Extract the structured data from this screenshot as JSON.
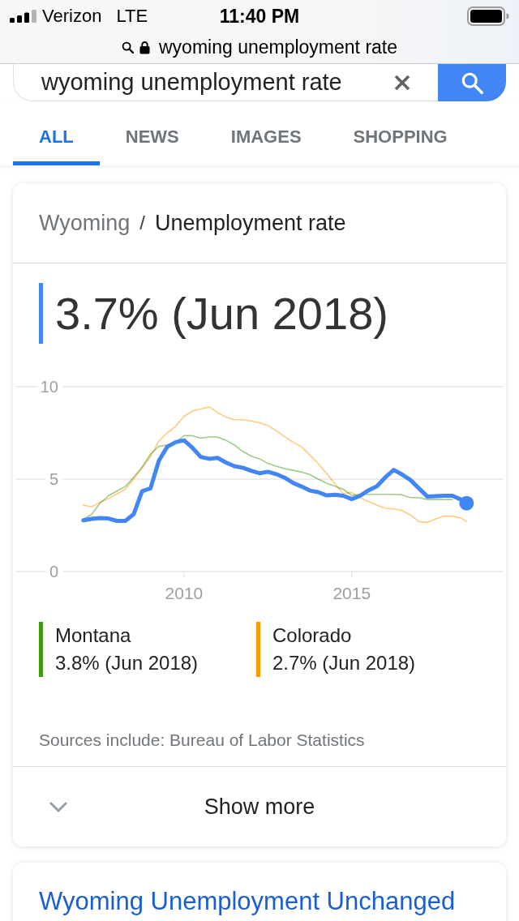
{
  "status_bar": {
    "carrier": "Verizon",
    "network": "LTE",
    "time": "11:40 PM"
  },
  "address_bar": {
    "url": "wyoming unemployment rate"
  },
  "search": {
    "value": "wyoming unemployment rate"
  },
  "tabs": [
    {
      "label": "ALL",
      "selected": true
    },
    {
      "label": "NEWS",
      "selected": false
    },
    {
      "label": "IMAGES",
      "selected": false
    },
    {
      "label": "SHOPPING",
      "selected": false
    }
  ],
  "card": {
    "breadcrumb": {
      "place": "Wyoming",
      "separator": "/",
      "topic": "Unemployment rate"
    },
    "headline": "3.7% (Jun 2018)",
    "chart_data": {
      "type": "line",
      "x": [
        2007,
        2007.25,
        2007.5,
        2007.75,
        2008,
        2008.25,
        2008.5,
        2008.75,
        2009,
        2009.25,
        2009.5,
        2009.75,
        2010,
        2010.25,
        2010.5,
        2010.75,
        2011,
        2011.25,
        2011.5,
        2011.75,
        2012,
        2012.25,
        2012.5,
        2012.75,
        2013,
        2013.25,
        2013.5,
        2013.75,
        2014,
        2014.25,
        2014.5,
        2014.75,
        2015,
        2015.25,
        2015.5,
        2015.75,
        2016,
        2016.25,
        2016.5,
        2016.75,
        2017,
        2017.25,
        2017.5,
        2017.75,
        2018,
        2018.25,
        2018.42
      ],
      "xlim": [
        2005,
        2019.5
      ],
      "ylim": [
        0,
        10
      ],
      "xticks": [
        2010,
        2015
      ],
      "yticks": [
        0,
        5,
        10
      ],
      "series": [
        {
          "color": "#4285f4",
          "values": [
            2.77,
            2.85,
            2.9,
            2.87,
            2.74,
            2.74,
            3.1,
            4.35,
            4.5,
            6.0,
            6.75,
            7.0,
            7.1,
            6.7,
            6.2,
            6.1,
            6.15,
            5.9,
            5.7,
            5.62,
            5.45,
            5.32,
            5.4,
            5.27,
            5.08,
            4.8,
            4.6,
            4.38,
            4.3,
            4.12,
            4.16,
            4.1,
            3.92,
            4.1,
            4.4,
            4.62,
            5.1,
            5.5,
            5.25,
            4.95,
            4.5,
            4.06,
            4.08,
            4.1,
            4.1,
            3.9,
            3.7
          ]
        },
        {
          "color": "#3f9a10",
          "values": [
            2.82,
            3.1,
            3.7,
            4.1,
            4.35,
            4.6,
            5.1,
            5.65,
            6.35,
            6.77,
            6.85,
            7.0,
            7.35,
            7.35,
            7.22,
            7.28,
            7.28,
            7.1,
            6.85,
            6.5,
            6.25,
            6.1,
            5.85,
            5.7,
            5.57,
            5.48,
            5.38,
            5.25,
            5.0,
            4.78,
            4.62,
            4.45,
            4.12,
            4.18,
            4.18,
            4.18,
            4.18,
            4.18,
            4.15,
            4.0,
            4.0,
            3.9,
            3.9,
            3.9,
            3.9,
            null,
            null
          ]
        },
        {
          "color": "#ff9800",
          "values": [
            3.6,
            3.5,
            3.75,
            3.95,
            4.2,
            4.45,
            5.0,
            5.6,
            6.2,
            7.07,
            7.5,
            7.86,
            8.4,
            8.68,
            8.8,
            8.91,
            8.6,
            8.35,
            8.21,
            8.21,
            8.15,
            8.05,
            7.9,
            7.62,
            7.3,
            7.0,
            6.75,
            6.3,
            5.84,
            5.3,
            4.75,
            4.22,
            4.28,
            4.0,
            3.78,
            3.6,
            3.42,
            3.39,
            3.3,
            3.06,
            2.7,
            2.66,
            2.85,
            3.0,
            3.0,
            2.9,
            2.7
          ]
        }
      ]
    },
    "comparisons": [
      {
        "name": "Montana",
        "reading": "3.8% (Jun 2018)",
        "color": "#3f9a10"
      },
      {
        "name": "Colorado",
        "reading": "2.7% (Jun 2018)",
        "color": "#ff9800"
      }
    ],
    "sources": "Sources include: Bureau of Labor Statistics",
    "show_more": "Show more"
  },
  "next_result": {
    "title": "Wyoming Unemployment Unchanged"
  }
}
